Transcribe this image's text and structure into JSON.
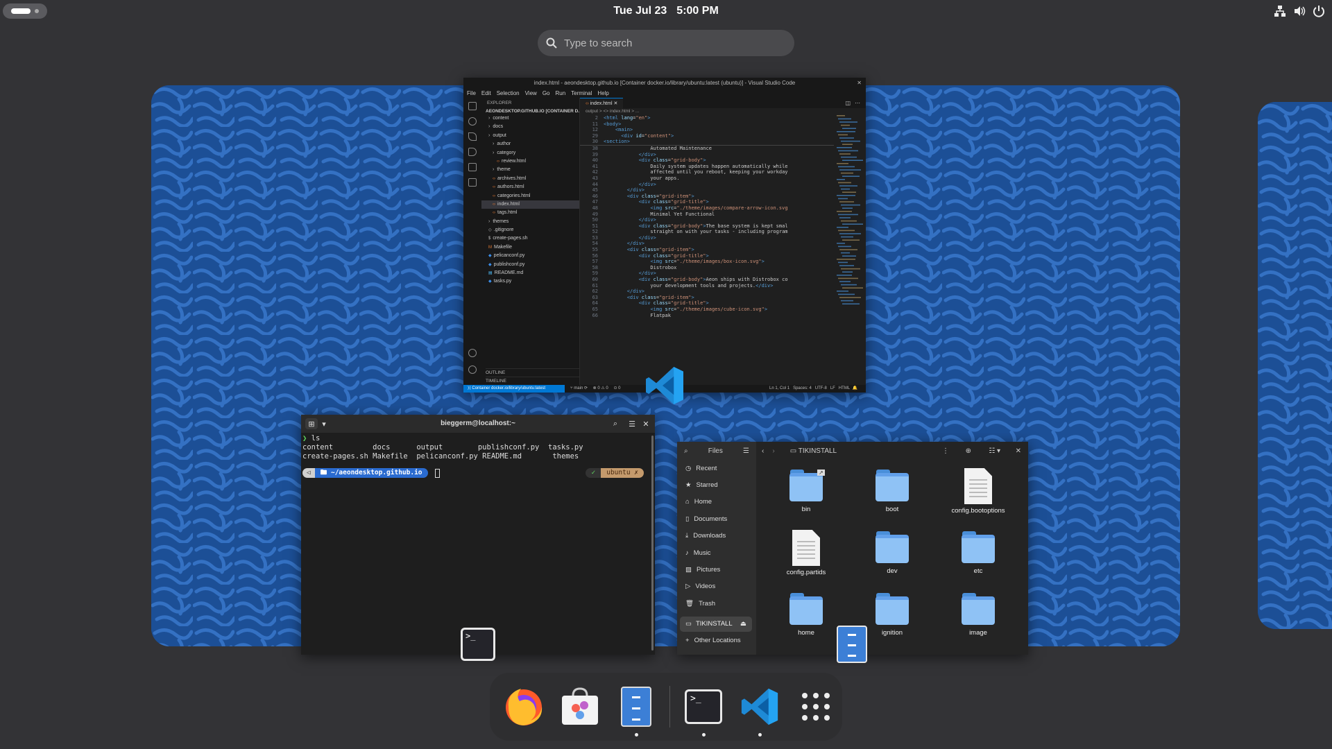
{
  "topbar": {
    "date": "Tue Jul 23",
    "time": "5:00 PM"
  },
  "search": {
    "placeholder": "Type to search"
  },
  "vscode": {
    "title": "index.html - aeondesktop.github.io [Container docker.io/library/ubuntu:latest (ubuntu)] - Visual Studio Code",
    "menu": [
      "File",
      "Edit",
      "Selection",
      "View",
      "Go",
      "Run",
      "Terminal",
      "Help"
    ],
    "explorer_header": "EXPLORER",
    "project": "AEONDESKTOP.GITHUB.IO [CONTAINER D...",
    "tree": [
      {
        "label": "content",
        "kind": "dir",
        "indent": 1
      },
      {
        "label": "docs",
        "kind": "dir",
        "indent": 1
      },
      {
        "label": "output",
        "kind": "dir",
        "indent": 1
      },
      {
        "label": "author",
        "kind": "dir",
        "indent": 2
      },
      {
        "label": "category",
        "kind": "dir",
        "indent": 2
      },
      {
        "label": "review.html",
        "kind": "file",
        "indent": 3
      },
      {
        "label": "theme",
        "kind": "dir",
        "indent": 2
      },
      {
        "label": "archives.html",
        "kind": "file",
        "indent": 2
      },
      {
        "label": "authors.html",
        "kind": "file",
        "indent": 2
      },
      {
        "label": "categories.html",
        "kind": "file",
        "indent": 2
      },
      {
        "label": "index.html",
        "kind": "file",
        "indent": 2,
        "selected": true
      },
      {
        "label": "tags.html",
        "kind": "file",
        "indent": 2
      },
      {
        "label": "themes",
        "kind": "dir",
        "indent": 1
      },
      {
        "label": ".gitignore",
        "kind": "gi",
        "indent": 1
      },
      {
        "label": "create-pages.sh",
        "kind": "sh",
        "indent": 1
      },
      {
        "label": "Makefile",
        "kind": "mk",
        "indent": 1
      },
      {
        "label": "pelicanconf.py",
        "kind": "py",
        "indent": 1
      },
      {
        "label": "publishconf.py",
        "kind": "py",
        "indent": 1
      },
      {
        "label": "README.md",
        "kind": "md",
        "indent": 1
      },
      {
        "label": "tasks.py",
        "kind": "py",
        "indent": 1
      }
    ],
    "outline": "OUTLINE",
    "timeline": "TIMELINE",
    "tab": "index.html",
    "breadcrumb": "output > <> index.html > ...",
    "sticky_lines": [
      {
        "n": "2",
        "html": "<span class='tag'>&lt;html</span> <span class='attr'>lang</span>=<span class='str'>\"en\"</span><span class='tag'>&gt;</span>"
      },
      {
        "n": "11",
        "html": "<span class='tag'>&lt;body&gt;</span>"
      },
      {
        "n": "12",
        "html": "    <span class='tag'>&lt;main&gt;</span>"
      },
      {
        "n": "29",
        "html": "      <span class='tag'>&lt;div</span> <span class='attr'>id</span>=<span class='str'>\"content\"</span><span class='tag'>&gt;</span>"
      },
      {
        "n": "30",
        "html": "<span class='tag'>&lt;section&gt;</span>"
      }
    ],
    "code_lines": [
      {
        "n": "38",
        "html": "                Automated Maintenance"
      },
      {
        "n": "39",
        "html": "            <span class='tag'>&lt;/div&gt;</span>"
      },
      {
        "n": "40",
        "html": "            <span class='tag'>&lt;div</span> <span class='attr'>class</span>=<span class='str'>\"grid-body\"</span><span class='tag'>&gt;</span>"
      },
      {
        "n": "41",
        "html": "                Daily system updates happen automatically while"
      },
      {
        "n": "42",
        "html": "                affected until you reboot, keeping your workday"
      },
      {
        "n": "43",
        "html": "                your apps."
      },
      {
        "n": "44",
        "html": "            <span class='tag'>&lt;/div&gt;</span>"
      },
      {
        "n": "45",
        "html": "        <span class='tag'>&lt;/div&gt;</span>"
      },
      {
        "n": "46",
        "html": "        <span class='tag'>&lt;div</span> <span class='attr'>class</span>=<span class='str'>\"grid-item\"</span><span class='tag'>&gt;</span>"
      },
      {
        "n": "47",
        "html": "            <span class='tag'>&lt;div</span> <span class='attr'>class</span>=<span class='str'>\"grid-title\"</span><span class='tag'>&gt;</span>"
      },
      {
        "n": "48",
        "html": "                <span class='tag'>&lt;img</span> <span class='attr'>src</span>=<span class='str'>\"./theme/images/compare-arrow-icon.svg</span>"
      },
      {
        "n": "49",
        "html": "                Minimal Yet Functional"
      },
      {
        "n": "50",
        "html": "            <span class='tag'>&lt;/div&gt;</span>"
      },
      {
        "n": "51",
        "html": "            <span class='tag'>&lt;div</span> <span class='attr'>class</span>=<span class='str'>\"grid-body\"</span><span class='tag'>&gt;</span>The base system is kept smal"
      },
      {
        "n": "52",
        "html": "                straight on with your tasks - including program"
      },
      {
        "n": "53",
        "html": "            <span class='tag'>&lt;/div&gt;</span>"
      },
      {
        "n": "54",
        "html": "        <span class='tag'>&lt;/div&gt;</span>"
      },
      {
        "n": "55",
        "html": "        <span class='tag'>&lt;div</span> <span class='attr'>class</span>=<span class='str'>\"grid-item\"</span><span class='tag'>&gt;</span>"
      },
      {
        "n": "56",
        "html": "            <span class='tag'>&lt;div</span> <span class='attr'>class</span>=<span class='str'>\"grid-title\"</span><span class='tag'>&gt;</span>"
      },
      {
        "n": "57",
        "html": "                <span class='tag'>&lt;img</span> <span class='attr'>src</span>=<span class='str'>\"./theme/images/box-icon.svg\"</span><span class='tag'>&gt;</span>"
      },
      {
        "n": "58",
        "html": "                Distrobox"
      },
      {
        "n": "59",
        "html": "            <span class='tag'>&lt;/div&gt;</span>"
      },
      {
        "n": "60",
        "html": "            <span class='tag'>&lt;div</span> <span class='attr'>class</span>=<span class='str'>\"grid-body\"</span><span class='tag'>&gt;</span>Aeon ships with Distrobox co"
      },
      {
        "n": "61",
        "html": "                your development tools and projects.<span class='tag'>&lt;/div&gt;</span>"
      },
      {
        "n": "62",
        "html": "        <span class='tag'>&lt;/div&gt;</span>"
      },
      {
        "n": "63",
        "html": "        <span class='tag'>&lt;div</span> <span class='attr'>class</span>=<span class='str'>\"grid-item\"</span><span class='tag'>&gt;</span>"
      },
      {
        "n": "64",
        "html": "            <span class='tag'>&lt;div</span> <span class='attr'>class</span>=<span class='str'>\"grid-title\"</span><span class='tag'>&gt;</span>"
      },
      {
        "n": "65",
        "html": "                <span class='tag'>&lt;img</span> <span class='attr'>src</span>=<span class='str'>\"./theme/images/cube-icon.svg\"</span><span class='tag'>&gt;</span>"
      },
      {
        "n": "66",
        "html": "                Flatpak"
      }
    ],
    "status": {
      "remote": "Container docker.io/library/ubuntu:latest",
      "branch": "main",
      "problems": "⊗ 0 ⚠ 0",
      "ports": "0",
      "position": "Ln 1, Col 1",
      "spaces": "Spaces: 4",
      "encoding": "UTF-8",
      "eol": "LF",
      "language": "HTML"
    }
  },
  "terminal": {
    "title": "bieggerm@localhost:~",
    "command": "ls",
    "output_line1": "content         docs      output        publishconf.py  tasks.py",
    "output_line2": "create-pages.sh Makefile  pelicanconf.py README.md       themes",
    "cwd": "~/aeondesktop.github.io",
    "container": "ubuntu"
  },
  "files": {
    "header": "Files",
    "location": "TIKINSTALL",
    "sidebar": [
      "Recent",
      "Starred",
      "Home",
      "Documents",
      "Downloads",
      "Music",
      "Pictures",
      "Videos",
      "Trash"
    ],
    "mounted": "TIKINSTALL",
    "other": "Other Locations",
    "items": [
      {
        "name": "bin",
        "type": "folder",
        "link": true
      },
      {
        "name": "boot",
        "type": "folder"
      },
      {
        "name": "config.bootoptions",
        "type": "doc"
      },
      {
        "name": "config.partids",
        "type": "doc"
      },
      {
        "name": "dev",
        "type": "folder"
      },
      {
        "name": "etc",
        "type": "folder"
      },
      {
        "name": "home",
        "type": "folder"
      },
      {
        "name": "ignition",
        "type": "folder"
      },
      {
        "name": "image",
        "type": "folder"
      }
    ]
  },
  "dock": {
    "apps": [
      {
        "name": "firefox",
        "running": false
      },
      {
        "name": "software",
        "running": false
      },
      {
        "name": "files",
        "running": true
      },
      {
        "name": "terminal",
        "running": true
      },
      {
        "name": "vscode",
        "running": true
      },
      {
        "name": "app-grid",
        "running": false
      }
    ]
  },
  "colors": {
    "accent": "#3584e4",
    "wallpaper": "#1c4f96",
    "vscode_blue": "#0078d4"
  }
}
